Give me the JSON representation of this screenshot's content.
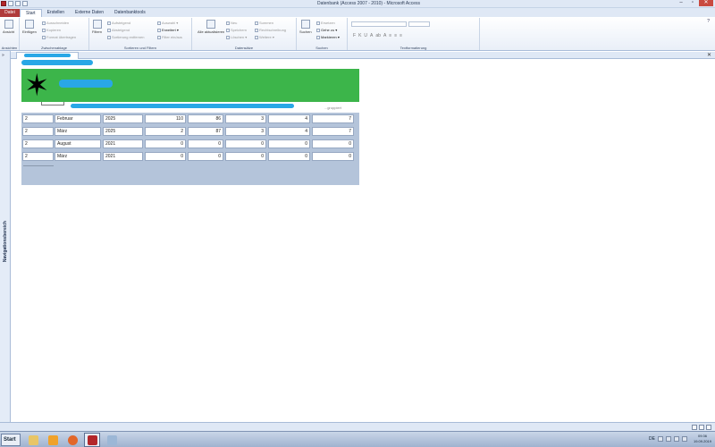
{
  "window": {
    "title": "Datenbank (Access 2007 - 2010)  -  Microsoft Access"
  },
  "tabs": [
    {
      "label": "Datei"
    },
    {
      "label": "Start"
    },
    {
      "label": "Erstellen"
    },
    {
      "label": "Externe Daten"
    },
    {
      "label": "Datenbanktools"
    }
  ],
  "ribbon": {
    "ansicht": {
      "button": "Ansicht",
      "group": "Ansichten"
    },
    "zwischenablage": {
      "paste": "Einfügen",
      "cut": "Ausschneiden",
      "copy": "Kopieren",
      "format": "Format übertragen",
      "group": "Zwischenablage"
    },
    "sortfilter": {
      "filter": "Filtern",
      "asc": "Aufsteigend",
      "desc": "Absteigend",
      "remove": "Sortierung entfernen",
      "auswahl": "Auswahl ▾",
      "erweitert": "Erweitert ▾",
      "toggle": "Filter ein/aus",
      "group": "Sortieren und Filtern"
    },
    "datensaetze": {
      "refresh": "Alle aktualisieren",
      "neu": "Neu",
      "speichern": "Speichern",
      "loeschen": "Löschen ▾",
      "summen": "Summen",
      "rechtschreibung": "Rechtschreibung",
      "weitere": "Weitere ▾",
      "group": "Datensätze"
    },
    "suchen": {
      "suchen": "Suchen",
      "ersetzen": "Ersetzen",
      "gehezu": "Gehe zu ▾",
      "markieren": "Markieren ▾",
      "group": "Suchen"
    },
    "text": {
      "group": "Textformatierung",
      "fmt": [
        "F",
        "K",
        "U",
        "A",
        "ab",
        "A"
      ]
    }
  },
  "nav": {
    "label": "Navigationsbereich",
    "toggle": "»"
  },
  "form": {
    "header_text": "...gruppiert",
    "rows": [
      {
        "c1": "2",
        "c2": "Februar",
        "c3": "2025",
        "c4": "110",
        "c5": "86",
        "c6": "3",
        "c7": "4",
        "c8": "7"
      },
      {
        "c1": "2",
        "c2": "März",
        "c3": "2025",
        "c4": "2",
        "c5": "87",
        "c6": "3",
        "c7": "4",
        "c8": "7"
      },
      {
        "c1": "2",
        "c2": "August",
        "c3": "2021",
        "c4": "0",
        "c5": "0",
        "c6": "0",
        "c7": "0",
        "c8": "0"
      },
      {
        "c1": "2",
        "c2": "März",
        "c3": "2021",
        "c4": "0",
        "c5": "0",
        "c6": "0",
        "c7": "0",
        "c8": "0"
      }
    ]
  },
  "taskbar": {
    "start": "Start",
    "lang": "DE",
    "time": "09:36",
    "date": "19.09.2019"
  },
  "colors": {
    "header_green": "#3cb54a",
    "detail_bg": "#b4c4da",
    "file_tab": "#b03a3a"
  }
}
